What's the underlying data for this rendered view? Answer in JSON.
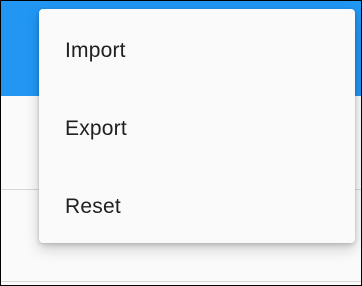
{
  "colors": {
    "app_bar": "#2196f3",
    "surface": "#fafafa",
    "text": "#202020"
  },
  "menu": {
    "items": [
      {
        "label": "Import"
      },
      {
        "label": "Export"
      },
      {
        "label": "Reset"
      }
    ]
  }
}
